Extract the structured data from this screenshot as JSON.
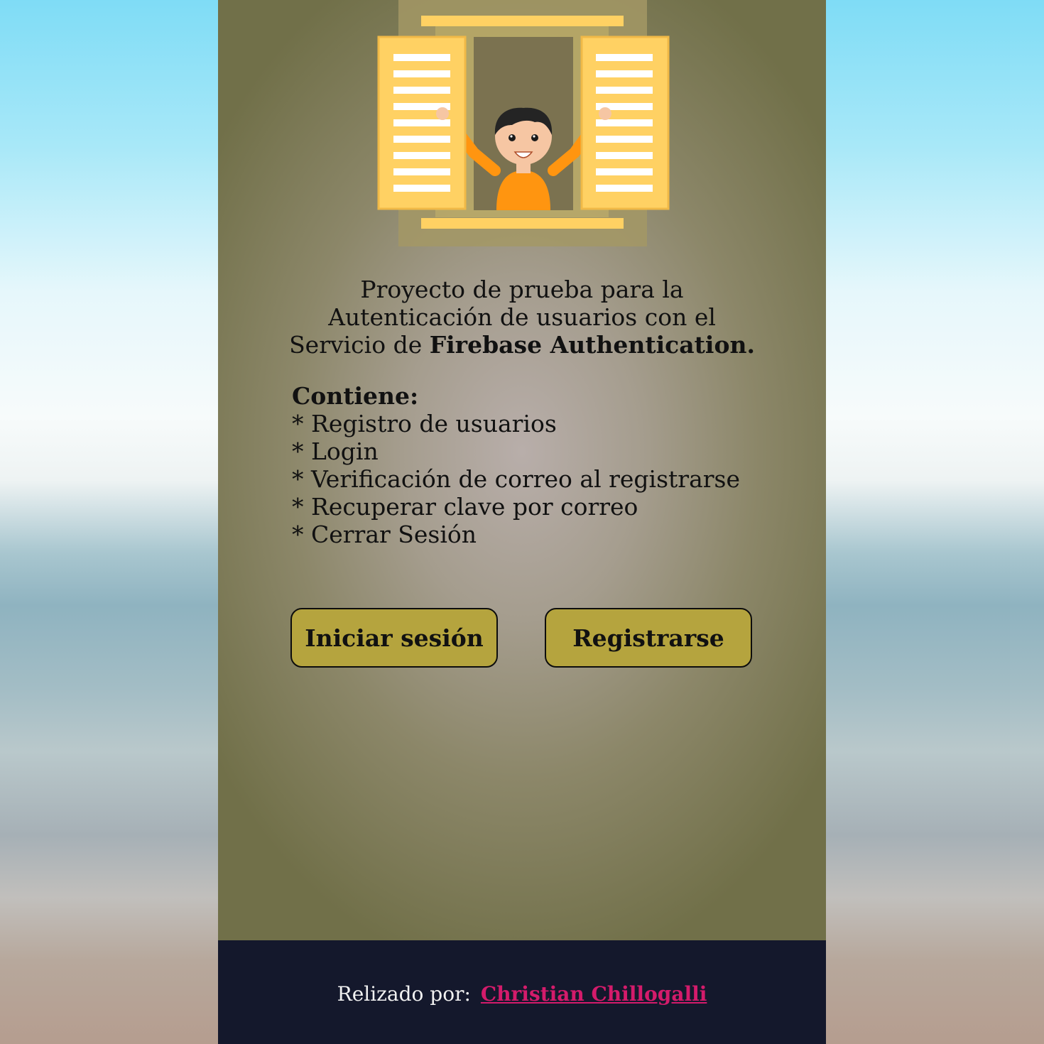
{
  "intro": {
    "text_part1": "Proyecto de prueba para la Autenticación de usuarios con el Servicio de ",
    "text_bold": "Firebase Authentication."
  },
  "features": {
    "heading": "Contiene:",
    "items": [
      "* Registro de usuarios",
      "* Login",
      "* Verificación de correo al registrarse",
      "* Recuperar clave por correo",
      "* Cerrar Sesión"
    ]
  },
  "buttons": {
    "login_label": "Iniciar sesión",
    "register_label": "Registrarse"
  },
  "footer": {
    "label": "Relizado por:",
    "author": "Christian Chillogalli"
  },
  "colors": {
    "button_bg": "#b5a43e",
    "footer_bg": "#14182c",
    "author_link": "#d41b6b",
    "shutter": "#ffd163",
    "shirt": "#ff9510"
  },
  "icons": {
    "hero": "person-waving-from-window-illustration"
  }
}
